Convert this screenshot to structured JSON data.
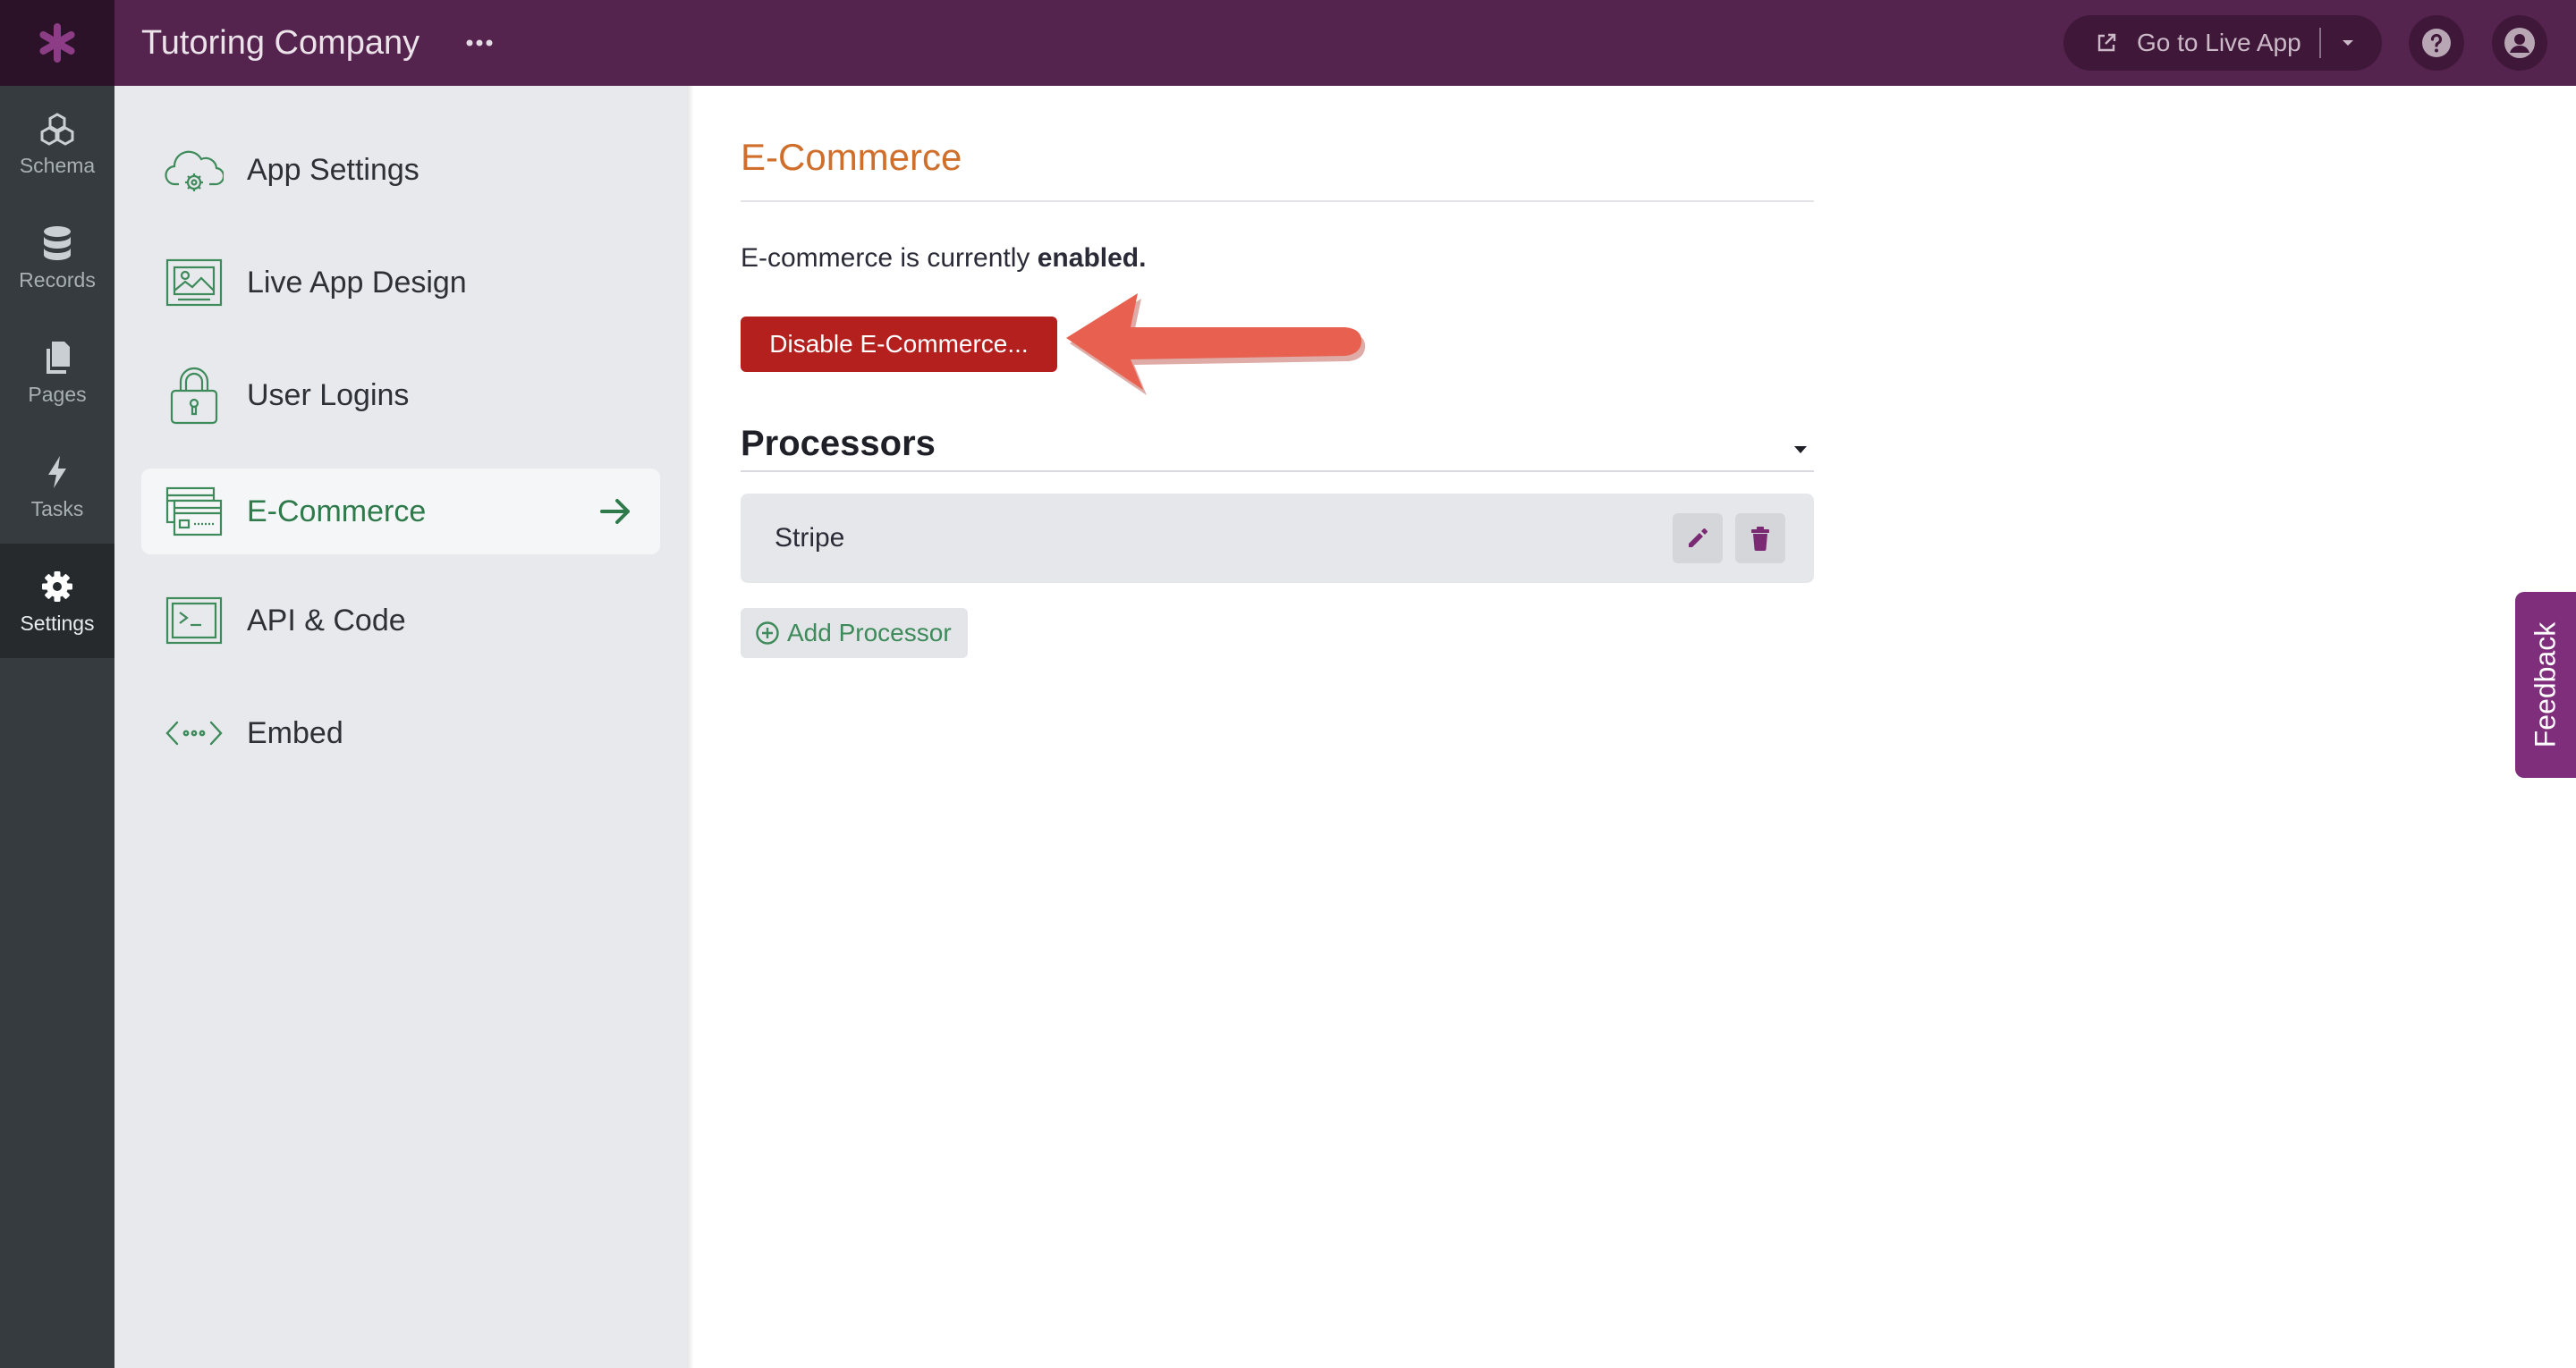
{
  "header": {
    "app_title": "Tutoring Company",
    "live_app_label": "Go to Live App"
  },
  "rail": {
    "items": [
      {
        "label": "Schema",
        "icon": "schema-icon"
      },
      {
        "label": "Records",
        "icon": "database-icon"
      },
      {
        "label": "Pages",
        "icon": "pages-icon"
      },
      {
        "label": "Tasks",
        "icon": "lightning-icon"
      },
      {
        "label": "Settings",
        "icon": "gear-icon",
        "active": true
      }
    ]
  },
  "settings_menu": {
    "items": [
      {
        "label": "App Settings",
        "icon": "cloud-gear-icon"
      },
      {
        "label": "Live App Design",
        "icon": "image-frame-icon"
      },
      {
        "label": "User Logins",
        "icon": "lock-icon"
      },
      {
        "label": "E-Commerce",
        "icon": "credit-card-icon",
        "active": true
      },
      {
        "label": "API & Code",
        "icon": "terminal-icon"
      },
      {
        "label": "Embed",
        "icon": "embed-code-icon"
      }
    ]
  },
  "main": {
    "title": "E-Commerce",
    "status_prefix": "E-commerce is currently",
    "status_value": "enabled.",
    "disable_button": "Disable E-Commerce...",
    "processors_title": "Processors",
    "processors": [
      {
        "name": "Stripe"
      }
    ],
    "add_processor_label": "Add Processor"
  },
  "feedback_label": "Feedback",
  "colors": {
    "topbar": "#54234e",
    "rail": "#353b3f",
    "accent_green": "#2e7a4a",
    "title_orange": "#cf6f2b",
    "danger_red": "#b4201e",
    "feedback_purple": "#7f2e7b"
  }
}
